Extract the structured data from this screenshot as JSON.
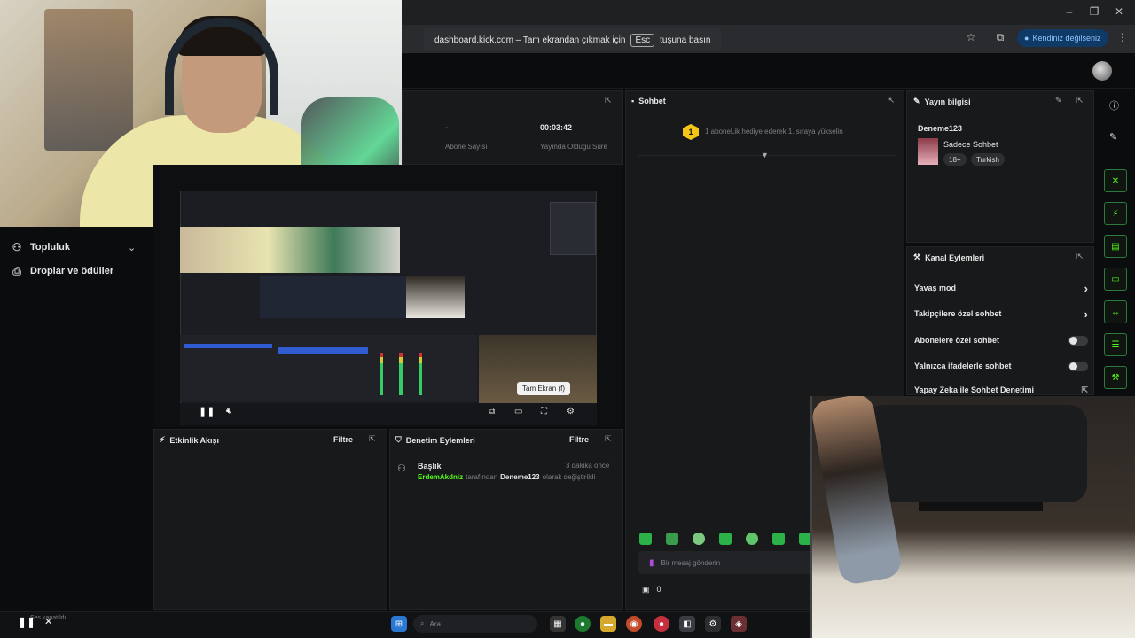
{
  "browser": {
    "fullscreen_prefix": "dashboard.kick.com – Tam ekrandan çıkmak için",
    "esc_key": "Esc",
    "fullscreen_suffix": "tuşuna basın",
    "profile_label": "Kendiniz değilseniz",
    "win_minimize": "–",
    "win_restore": "❐",
    "win_close": "✕"
  },
  "left_nav": {
    "items": [
      {
        "label": "Topluluk",
        "icon": "community-icon"
      },
      {
        "label": "Droplar ve ödüller",
        "icon": "gift-icon"
      }
    ]
  },
  "stats": {
    "subscribers_value": "-",
    "subscribers_label": "Abone Sayısı",
    "live_time_value": "00:03:42",
    "live_time_label": "Yayında Olduğu Süre"
  },
  "video": {
    "tooltip": "Tam Ekran (f)"
  },
  "activity": {
    "title": "Etkinlik Akışı",
    "filter": "Filtre"
  },
  "moderation": {
    "title": "Denetim Eylemleri",
    "filter": "Filtre",
    "entry_title": "Başlık",
    "entry_time": "3 dakika önce",
    "entry_user": "ErdemAkdniz",
    "entry_mid": "tarafından",
    "entry_value": "Deneme123",
    "entry_suffix": "olarak değiştirildi"
  },
  "chat": {
    "title": "Sohbet",
    "gift_badge": "1",
    "gift_text": "1 aboneLik hediye ederek 1. sıraya yükselin",
    "input_placeholder": "Bir mesaj gönderin",
    "kicks_count": "0"
  },
  "stream_info": {
    "title": "Yayın bilgisi",
    "stream_title": "Deneme123",
    "category": "Sadece Sohbet",
    "tags": [
      "18+",
      "Turkish"
    ]
  },
  "channel_actions": {
    "title": "Kanal Eylemleri",
    "rows": [
      {
        "label": "Yavaş mod",
        "control": "chevron"
      },
      {
        "label": "Takipçilere özel sohbet",
        "control": "chevron"
      },
      {
        "label": "Abonelere özel sohbet",
        "control": "toggle"
      },
      {
        "label": "Yalnızca ifadelerle sohbet",
        "control": "toggle"
      },
      {
        "label": "Yapay Zeka ile Sohbet Denetimi",
        "control": "external"
      }
    ]
  },
  "taskbar": {
    "search_placeholder": "Ara",
    "overlay_text": "Ses kapatıldı"
  },
  "colors": {
    "kick_green": "#53fc18",
    "panel_bg": "#18191b",
    "page_bg": "#0b0c0d"
  }
}
